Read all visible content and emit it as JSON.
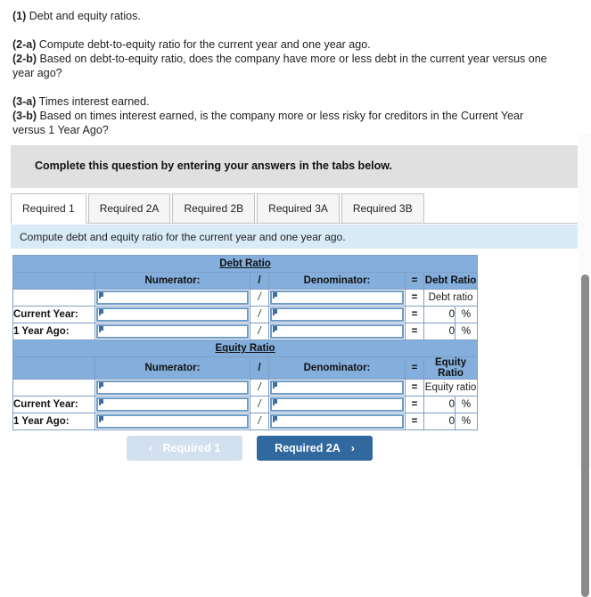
{
  "prompt": {
    "lines": [
      {
        "bold": "(1)",
        "text": " Debt and equity ratios."
      },
      {
        "bold": "",
        "text": ""
      },
      {
        "bold": "(2-a)",
        "text": " Compute debt-to-equity ratio for the current year and one year ago."
      },
      {
        "bold": "(2-b)",
        "text": " Based on debt-to-equity ratio, does the company have more or less debt in the current year versus one year ago?"
      },
      {
        "bold": "",
        "text": ""
      },
      {
        "bold": "(3-a)",
        "text": " Times interest earned."
      },
      {
        "bold": "(3-b)",
        "text": " Based on times interest earned, is the company more or less risky for creditors in the Current Year versus 1 Year Ago?"
      }
    ],
    "line1_bold": "(1)",
    "line1_text": " Debt and equity ratios.",
    "line2a_bold": "(2-a)",
    "line2a_text": " Compute debt-to-equity ratio for the current year and one year ago.",
    "line2b_bold": "(2-b)",
    "line2b_text": " Based on debt-to-equity ratio, does the company have more or less debt in the current year versus one year ago?",
    "line3a_bold": "(3-a)",
    "line3a_text": " Times interest earned.",
    "line3b_bold": "(3-b)",
    "line3b_text": " Based on times interest earned, is the company more or less risky for creditors in the Current Year versus 1 Year Ago?"
  },
  "instruction_band": {
    "text": "Complete this question by entering your answers in the tabs below."
  },
  "tabs": {
    "items": [
      {
        "label": "Required 1",
        "active": true
      },
      {
        "label": "Required 2A",
        "active": false
      },
      {
        "label": "Required 2B",
        "active": false
      },
      {
        "label": "Required 3A",
        "active": false
      },
      {
        "label": "Required 3B",
        "active": false
      }
    ]
  },
  "sub_instruction": {
    "text": "Compute debt and equity ratio for the current year and one year ago."
  },
  "worksheet": {
    "sections": [
      {
        "title": "Debt Ratio",
        "headers": {
          "label": "",
          "numerator": "Numerator:",
          "slash": "/",
          "denominator": "Denominator:",
          "equals": "=",
          "result": "Debt Ratio"
        },
        "rows": [
          {
            "label": "",
            "numerator_value": "",
            "slash": "/",
            "denominator_value": "",
            "equals": "=",
            "result": "Debt ratio",
            "result_kind": "text",
            "pct": ""
          },
          {
            "label": "Current Year:",
            "numerator_value": "",
            "slash": "/",
            "denominator_value": "",
            "equals": "=",
            "result": "0",
            "result_kind": "number",
            "pct": "%"
          },
          {
            "label": "1 Year Ago:",
            "numerator_value": "",
            "slash": "/",
            "denominator_value": "",
            "equals": "=",
            "result": "0",
            "result_kind": "number",
            "pct": "%"
          }
        ]
      },
      {
        "title": "Equity Ratio",
        "headers": {
          "label": "",
          "numerator": "Numerator:",
          "slash": "/",
          "denominator": "Denominator:",
          "equals": "=",
          "result": "Equity Ratio"
        },
        "rows": [
          {
            "label": "",
            "numerator_value": "",
            "slash": "/",
            "denominator_value": "",
            "equals": "=",
            "result": "Equity ratio",
            "result_kind": "text",
            "pct": ""
          },
          {
            "label": "Current Year:",
            "numerator_value": "",
            "slash": "/",
            "denominator_value": "",
            "equals": "=",
            "result": "0",
            "result_kind": "number",
            "pct": "%"
          },
          {
            "label": "1 Year Ago:",
            "numerator_value": "",
            "slash": "/",
            "denominator_value": "",
            "equals": "=",
            "result": "0",
            "result_kind": "number",
            "pct": "%"
          }
        ]
      }
    ]
  },
  "footer": {
    "prev_label": "Required 1",
    "prev_chevron": "‹",
    "next_label": "Required 2A",
    "next_chevron": "›"
  },
  "colors": {
    "header_blue": "#84aedb",
    "grid_blue": "#7e9fc4",
    "info_blue": "#d9ebf7",
    "band_gray": "#e0e0e0",
    "btn_primary": "#31699f",
    "btn_disabled": "#d3e0ef",
    "entry_border": "#6f9bc6"
  }
}
